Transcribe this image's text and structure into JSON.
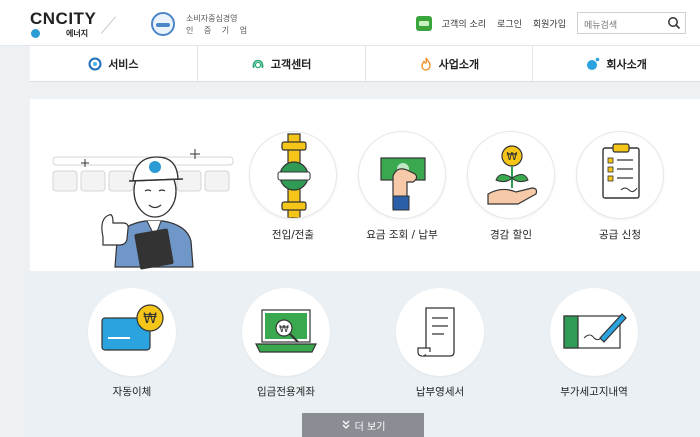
{
  "header": {
    "brand": "CNCITY",
    "brand_sub": "에너지",
    "cert_line1": "소비자중심경영",
    "cert_line2": "인 증 기 업",
    "voice_label": "고객의 소리",
    "login_label": "로그인",
    "signup_label": "회원가입",
    "search_placeholder": "메뉴검색"
  },
  "main_nav": [
    {
      "label": "서비스",
      "icon": "service-icon"
    },
    {
      "label": "고객센터",
      "icon": "headset-icon"
    },
    {
      "label": "사업소개",
      "icon": "flame-icon"
    },
    {
      "label": "회사소개",
      "icon": "bubble-icon"
    }
  ],
  "services_top": [
    {
      "label": "전입/전출",
      "icon": "gas-pipe-icon"
    },
    {
      "label": "요금 조회 / 납부",
      "icon": "payment-hand-icon"
    },
    {
      "label": "경감 할인",
      "icon": "plant-coin-icon"
    },
    {
      "label": "공급 신청",
      "icon": "clipboard-icon"
    }
  ],
  "services_bottom": [
    {
      "label": "자동이체",
      "icon": "card-won-icon"
    },
    {
      "label": "입금전용계좌",
      "icon": "laptop-won-icon"
    },
    {
      "label": "납부영세서",
      "icon": "receipt-icon"
    },
    {
      "label": "부가세고지내역",
      "icon": "pen-document-icon"
    }
  ],
  "more_label": "더 보기",
  "colors": {
    "brand_blue": "#2b9bd3",
    "accent_green": "#3aa53a",
    "accent_yellow": "#f5c518",
    "more_btn_bg": "#8a8e94"
  }
}
